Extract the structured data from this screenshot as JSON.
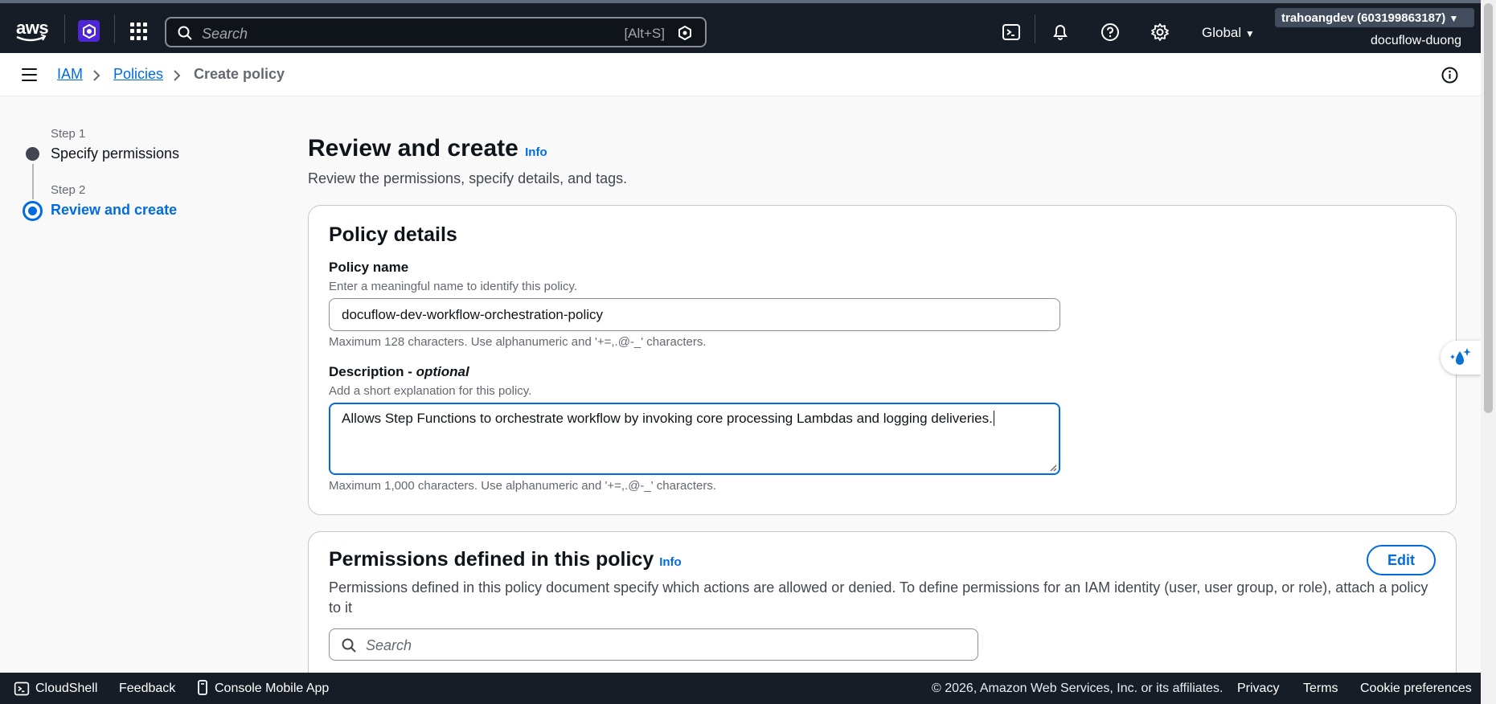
{
  "topbar": {
    "logo": "aws",
    "search_placeholder": "Search",
    "search_shortcut": "[Alt+S]",
    "region": "Global",
    "account": "trahoangdev (603199863187)",
    "user": "docuflow-duong",
    "icons": [
      "cloudshell-icon",
      "bell-icon",
      "help-icon",
      "settings-icon"
    ]
  },
  "breadcrumb": {
    "items": [
      "IAM",
      "Policies",
      "Create policy"
    ]
  },
  "steps": [
    {
      "num": "Step 1",
      "title": "Specify permissions"
    },
    {
      "num": "Step 2",
      "title": "Review and create"
    }
  ],
  "page": {
    "title": "Review and create",
    "info": "Info",
    "subtitle": "Review the permissions, specify details, and tags."
  },
  "policy_details": {
    "title": "Policy details",
    "name_label": "Policy name",
    "name_hint": "Enter a meaningful name to identify this policy.",
    "name_value": "docuflow-dev-workflow-orchestration-policy",
    "name_constraint": "Maximum 128 characters. Use alphanumeric and '+=,.@-_' characters.",
    "desc_label": "Description - ",
    "desc_label_optional": "optional",
    "desc_hint": "Add a short explanation for this policy.",
    "desc_value": "Allows Step Functions to orchestrate workflow by invoking core processing Lambdas and logging deliveries.",
    "desc_constraint": "Maximum 1,000 characters. Use alphanumeric and '+=,.@-_' characters."
  },
  "permissions": {
    "title": "Permissions defined in this policy",
    "info": "Info",
    "edit": "Edit",
    "description": "Permissions defined in this policy document specify which actions are allowed or denied. To define permissions for an IAM identity (user, user group, or role), attach a policy to it",
    "search_placeholder": "Search"
  },
  "footer": {
    "cloudshell": "CloudShell",
    "feedback": "Feedback",
    "mobile": "Console Mobile App",
    "copyright": "© 2026, Amazon Web Services, Inc. or its affiliates.",
    "privacy": "Privacy",
    "terms": "Terms",
    "cookies": "Cookie preferences"
  },
  "colors": {
    "nav_bg": "#161d26",
    "link": "#006ce0",
    "text": "#0f141a"
  }
}
